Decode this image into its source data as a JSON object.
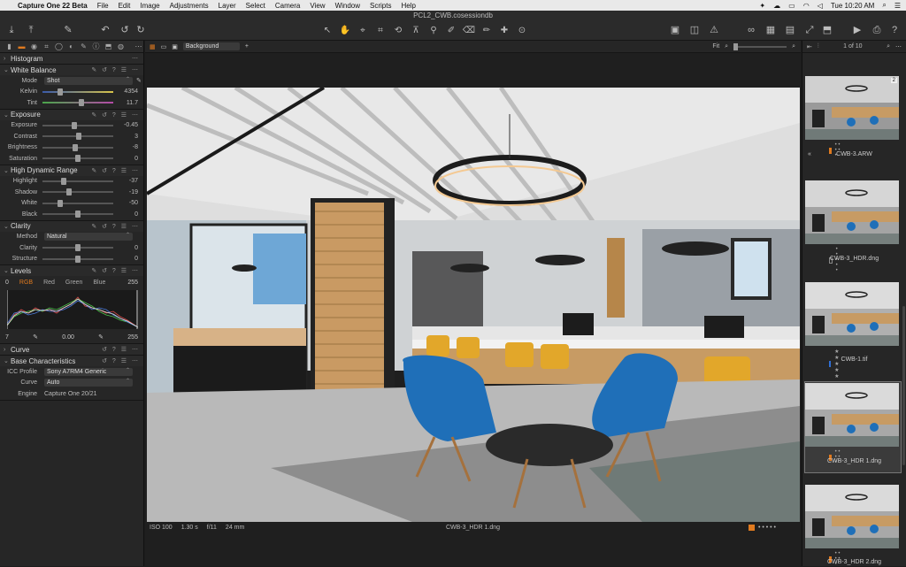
{
  "menubar": {
    "app_name": "Capture One 22 Beta",
    "items": [
      "File",
      "Edit",
      "Image",
      "Adjustments",
      "Layer",
      "Select",
      "Camera",
      "View",
      "Window",
      "Scripts",
      "Help"
    ],
    "clock": "Tue 10:20 AM"
  },
  "window": {
    "title": "PCL2_CWB.cosessiondb"
  },
  "tool_tabs": [
    "library",
    "adjust",
    "lens",
    "crop",
    "exposure",
    "color",
    "details",
    "metadata",
    "output",
    "batch"
  ],
  "panels": {
    "histogram": {
      "title": "Histogram"
    },
    "white_balance": {
      "title": "White Balance",
      "mode_label": "Mode",
      "mode_value": "Shot",
      "kelvin_label": "Kelvin",
      "kelvin_value": "4354",
      "kelvin_pos": 0.25,
      "tint_label": "Tint",
      "tint_value": "11.7",
      "tint_pos": 0.55
    },
    "exposure": {
      "title": "Exposure",
      "rows": [
        {
          "label": "Exposure",
          "value": "-0.45",
          "pos": 0.45
        },
        {
          "label": "Contrast",
          "value": "3",
          "pos": 0.51
        },
        {
          "label": "Brightness",
          "value": "-8",
          "pos": 0.46
        },
        {
          "label": "Saturation",
          "value": "0",
          "pos": 0.5
        }
      ]
    },
    "hdr": {
      "title": "High Dynamic Range",
      "rows": [
        {
          "label": "Highlight",
          "value": "-37",
          "pos": 0.3
        },
        {
          "label": "Shadow",
          "value": "-19",
          "pos": 0.38
        },
        {
          "label": "White",
          "value": "-50",
          "pos": 0.25
        },
        {
          "label": "Black",
          "value": "0",
          "pos": 0.5
        }
      ]
    },
    "clarity": {
      "title": "Clarity",
      "method_label": "Method",
      "method_value": "Natural",
      "rows": [
        {
          "label": "Clarity",
          "value": "0",
          "pos": 0.5
        },
        {
          "label": "Structure",
          "value": "0",
          "pos": 0.5
        }
      ]
    },
    "levels": {
      "title": "Levels",
      "channels": [
        "RGB",
        "Red",
        "Green",
        "Blue"
      ],
      "active_channel": "RGB",
      "in_low": "0",
      "in_high": "255",
      "out_low": "7",
      "mid": "0.00",
      "out_high": "255"
    },
    "curve": {
      "title": "Curve"
    },
    "base": {
      "title": "Base Characteristics",
      "icc_label": "ICC Profile",
      "icc_value": "Sony A7RM4 Generic",
      "curve_label": "Curve",
      "curve_value": "Auto",
      "engine_label": "Engine",
      "engine_value": "Capture One 20/21"
    }
  },
  "viewer": {
    "background_select": "Background",
    "zoom_label": "Fit",
    "iso": "ISO 100",
    "shutter": "1.30 s",
    "aperture": "f/11",
    "focal": "24 mm",
    "filename": "CWB-3_HDR 1.dng",
    "rating_color": "#e07a1f"
  },
  "browser": {
    "counter": "1 of 10",
    "thumbs": [
      {
        "name": "CWB-3.ARW",
        "badge": "2",
        "color": "#e07a1f",
        "stars": "• • • • •"
      },
      {
        "name": "CWB-3_HDR.dng",
        "color": "none",
        "stars": "• • • • •"
      },
      {
        "name": "CWB-1.tif",
        "color": "#2f6fd6",
        "stars": "★ ★ ★ ★ ★"
      },
      {
        "name": "CWB-3_HDR 1.dng",
        "color": "#e07a1f",
        "stars": "• • • • •"
      },
      {
        "name": "CWB-3_HDR 2.dng",
        "color": "#e07a1f",
        "stars": "• • • • •"
      }
    ]
  },
  "colors": {
    "accent": "#e07a1f",
    "panel": "#262626",
    "toolbar": "#2b2b2b"
  }
}
